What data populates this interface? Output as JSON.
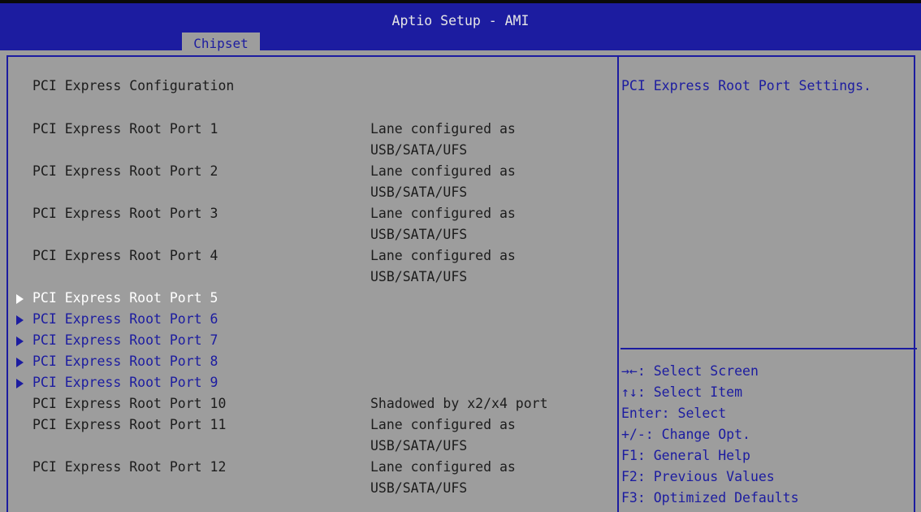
{
  "app_title": "Aptio Setup - AMI",
  "active_tab": "Chipset",
  "section_title": "PCI Express Configuration",
  "rows": [
    {
      "label": "PCI Express Root Port 1",
      "value": "Lane configured as\nUSB/SATA/UFS",
      "type": "info"
    },
    {
      "label": "PCI Express Root Port 2",
      "value": "Lane configured as\nUSB/SATA/UFS",
      "type": "info"
    },
    {
      "label": "PCI Express Root Port 3",
      "value": "Lane configured as\nUSB/SATA/UFS",
      "type": "info"
    },
    {
      "label": "PCI Express Root Port 4",
      "value": "Lane configured as\nUSB/SATA/UFS",
      "type": "info"
    },
    {
      "label": "PCI Express Root Port 5",
      "value": "",
      "type": "submenu",
      "selected": true
    },
    {
      "label": "PCI Express Root Port 6",
      "value": "",
      "type": "submenu"
    },
    {
      "label": "PCI Express Root Port 7",
      "value": "",
      "type": "submenu"
    },
    {
      "label": "PCI Express Root Port 8",
      "value": "",
      "type": "submenu"
    },
    {
      "label": "PCI Express Root Port 9",
      "value": "",
      "type": "submenu"
    },
    {
      "label": "PCI Express Root Port 10",
      "value": "Shadowed by x2/x4 port",
      "type": "info"
    },
    {
      "label": "PCI Express Root Port 11",
      "value": "Lane configured as\nUSB/SATA/UFS",
      "type": "info"
    },
    {
      "label": "PCI Express Root Port 12",
      "value": "Lane configured as\nUSB/SATA/UFS",
      "type": "info"
    }
  ],
  "help": {
    "text": "PCI Express Root Port Settings.",
    "keys": [
      "→←: Select Screen",
      "↑↓: Select Item",
      "Enter: Select",
      "+/-: Change Opt.",
      "F1: General Help",
      "F2: Previous Values",
      "F3: Optimized Defaults"
    ]
  },
  "colors": {
    "background": "#9d9d9d",
    "header": "#1c1ca0",
    "accent_text": "#1c1ca0",
    "selected_text": "#ffffff",
    "normal_text": "#1c1c1c"
  }
}
